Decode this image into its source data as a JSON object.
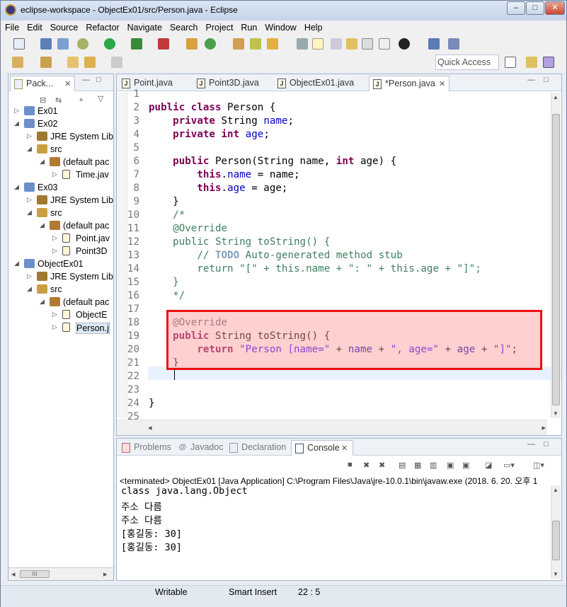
{
  "window": {
    "title": "eclipse-workspace - ObjectEx01/src/Person.java - Eclipse",
    "minimize": "–",
    "maximize": "□",
    "close": "✕"
  },
  "menu": [
    "File",
    "Edit",
    "Source",
    "Refactor",
    "Navigate",
    "Search",
    "Project",
    "Run",
    "Window",
    "Help"
  ],
  "quick_access": "Quick Access",
  "explorer": {
    "tab": "Pack...",
    "tree": [
      {
        "label": "Ex01",
        "indent": 0,
        "tw": "▷",
        "icon": "project"
      },
      {
        "label": "Ex02",
        "indent": 0,
        "tw": "◢",
        "icon": "project"
      },
      {
        "label": "JRE System Lib",
        "indent": 1,
        "tw": "▷",
        "icon": "library"
      },
      {
        "label": "src",
        "indent": 1,
        "tw": "◢",
        "icon": "source-folder"
      },
      {
        "label": "(default pac",
        "indent": 2,
        "tw": "◢",
        "icon": "package"
      },
      {
        "label": "Time.jav",
        "indent": 3,
        "tw": "▷",
        "icon": "java-file"
      },
      {
        "label": "Ex03",
        "indent": 0,
        "tw": "◢",
        "icon": "project"
      },
      {
        "label": "JRE System Lib",
        "indent": 1,
        "tw": "▷",
        "icon": "library"
      },
      {
        "label": "src",
        "indent": 1,
        "tw": "◢",
        "icon": "source-folder"
      },
      {
        "label": "(default pac",
        "indent": 2,
        "tw": "◢",
        "icon": "package"
      },
      {
        "label": "Point.jav",
        "indent": 3,
        "tw": "▷",
        "icon": "java-file"
      },
      {
        "label": "Point3D",
        "indent": 3,
        "tw": "▷",
        "icon": "java-file"
      },
      {
        "label": "ObjectEx01",
        "indent": 0,
        "tw": "◢",
        "icon": "project"
      },
      {
        "label": "JRE System Lib",
        "indent": 1,
        "tw": "▷",
        "icon": "library"
      },
      {
        "label": "src",
        "indent": 1,
        "tw": "◢",
        "icon": "source-folder"
      },
      {
        "label": "(default pac",
        "indent": 2,
        "tw": "◢",
        "icon": "package"
      },
      {
        "label": "ObjectE",
        "indent": 3,
        "tw": "▷",
        "icon": "java-file"
      },
      {
        "label": "Person.j",
        "indent": 3,
        "tw": "▷",
        "icon": "java-file",
        "selected": true
      }
    ],
    "hscroll_thumb": "III"
  },
  "editor": {
    "tabs": [
      "Point.java",
      "Point3D.java",
      "ObjectEx01.java",
      "*Person.java"
    ],
    "active_tab": 3,
    "lines": [
      {
        "n": "1",
        "html": ""
      },
      {
        "n": "2",
        "html": "<span class=\"kw\">public class</span> Person {"
      },
      {
        "n": "3",
        "html": "    <span class=\"kw\">private</span> String <span class=\"fld\">name</span>;"
      },
      {
        "n": "4",
        "html": "    <span class=\"kw\">private int</span> <span class=\"fld\">age</span>;"
      },
      {
        "n": "5",
        "html": ""
      },
      {
        "n": "6",
        "html": "    <span class=\"kw\">public</span> Person(String name, <span class=\"kw\">int</span> age) {"
      },
      {
        "n": "7",
        "html": "        <span class=\"kw\">this</span>.<span class=\"fld\">name</span> = name;"
      },
      {
        "n": "8",
        "html": "        <span class=\"kw\">this</span>.<span class=\"fld\">age</span> = age;"
      },
      {
        "n": "9",
        "html": "    }"
      },
      {
        "n": "10",
        "html": "    <span class=\"cm\">/*</span>"
      },
      {
        "n": "11",
        "html": "    <span class=\"cm\">@Override</span>"
      },
      {
        "n": "12",
        "html": "    <span class=\"cm\">public String toString() {</span>"
      },
      {
        "n": "13",
        "html": "        <span class=\"cm\">// </span><span class=\"todo\">TODO</span><span class=\"cm\"> Auto-generated method stub</span>"
      },
      {
        "n": "14",
        "html": "        <span class=\"cm\">return \"[\" + this.name + \": \" + this.age + \"]\";</span>"
      },
      {
        "n": "15",
        "html": "    <span class=\"cm\">}</span>"
      },
      {
        "n": "16",
        "html": "    <span class=\"cm\">*/</span>"
      },
      {
        "n": "17",
        "html": ""
      },
      {
        "n": "18",
        "html": "    <span class=\"an\">@Override</span>"
      },
      {
        "n": "19",
        "html": "    <span class=\"kw\">public</span> String toString() {"
      },
      {
        "n": "20",
        "html": "        <span class=\"kw\">return</span> <span class=\"str\">\"Person [name=\"</span> + <span class=\"fld\">name</span> + <span class=\"str\">\", age=\"</span> + <span class=\"fld\">age</span> + <span class=\"str\">\"]\"</span>;"
      },
      {
        "n": "21",
        "html": "    }"
      },
      {
        "n": "22",
        "html": "    "
      },
      {
        "n": "23",
        "html": ""
      },
      {
        "n": "24",
        "html": "}"
      },
      {
        "n": "25",
        "html": ""
      }
    ]
  },
  "bottom": {
    "tabs": [
      "Problems",
      "Javadoc",
      "Declaration",
      "Console"
    ],
    "active_tab": 3,
    "console_header": "<terminated> ObjectEx01 [Java Application] C:\\Program Files\\Java\\jre-10.0.1\\bin\\javaw.exe (2018. 6. 20. 오후 1",
    "output": [
      "class java.lang.Object",
      "주소 다름",
      "주소 다름",
      "[홍길동: 30]",
      "[홍길동: 30]"
    ]
  },
  "status": {
    "mode": "Writable",
    "insert": "Smart Insert",
    "position": "22 : 5"
  }
}
